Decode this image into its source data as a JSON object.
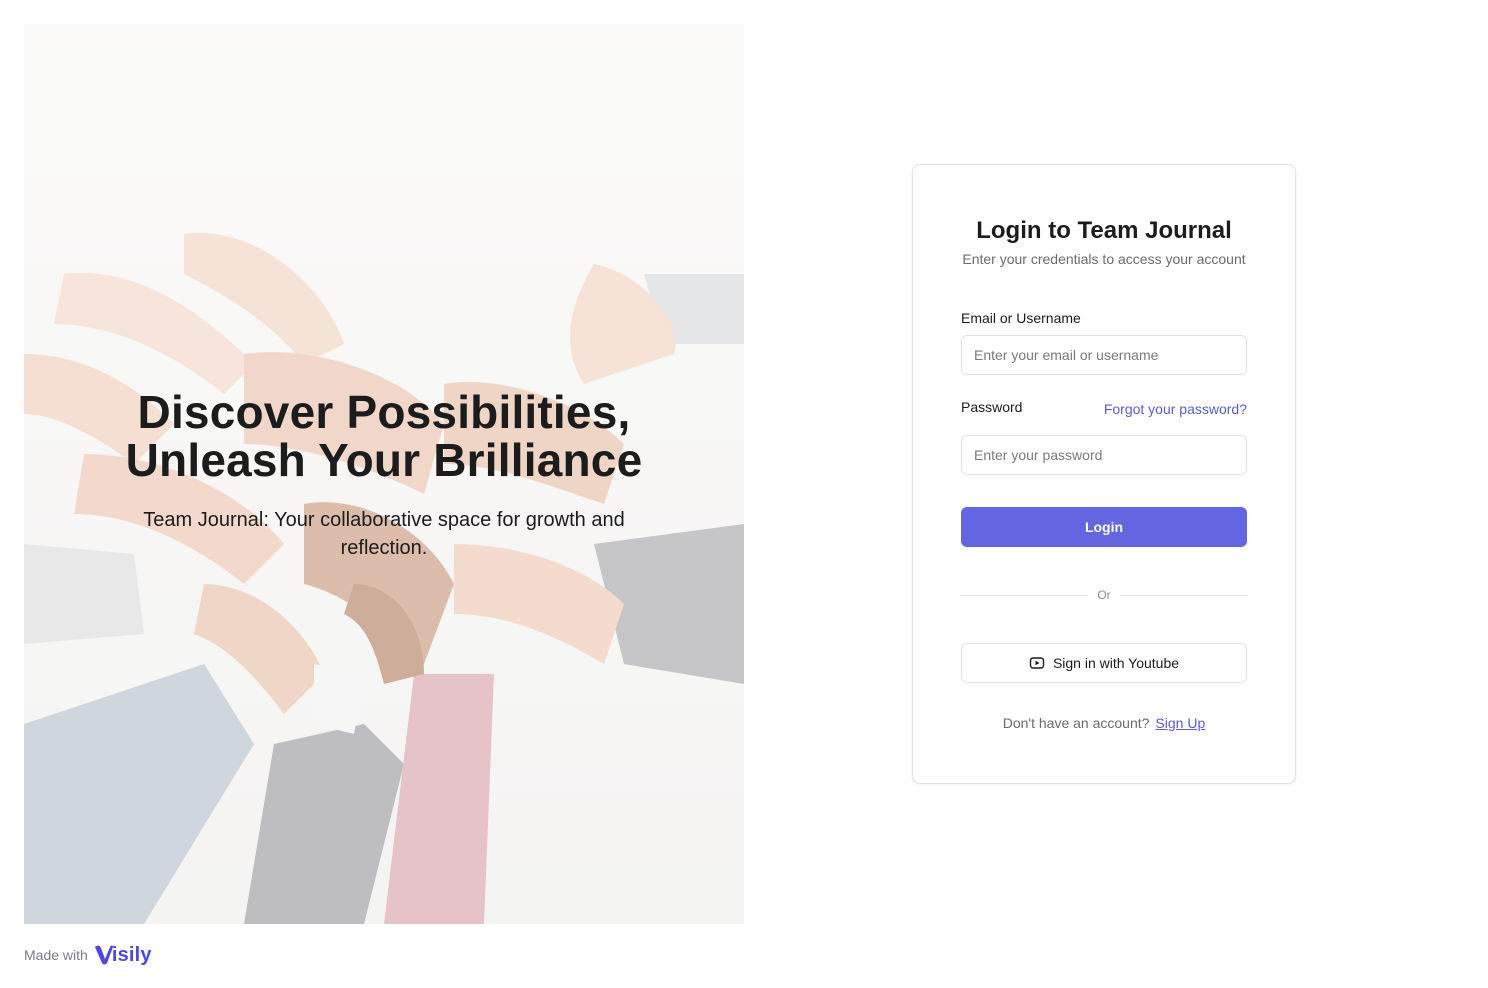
{
  "hero": {
    "title": "Discover Possibilities,\nUnleash Your Brilliance",
    "subtitle": "Team Journal: Your collaborative space for growth and reflection."
  },
  "footer": {
    "made_with": "Made with",
    "brand": "isily"
  },
  "login": {
    "title": "Login to Team Journal",
    "subtitle": "Enter your credentials to access your account",
    "email_label": "Email or Username",
    "email_placeholder": "Enter your email or username",
    "email_value": "",
    "password_label": "Password",
    "forgot_link": "Forgot your password?",
    "password_placeholder": "Enter your password",
    "password_value": "",
    "login_button": "Login",
    "divider": "Or",
    "youtube_button": "Sign in with Youtube",
    "signup_prompt": "Don't have an account?",
    "signup_link": "Sign Up"
  },
  "icons": {
    "youtube": "youtube-icon",
    "brand_logo": "visily-logo-icon"
  },
  "colors": {
    "accent": "#6366e0",
    "link": "#5b5bd6",
    "card_border": "#e3e3e3",
    "muted_text": "#6b6b6b"
  }
}
